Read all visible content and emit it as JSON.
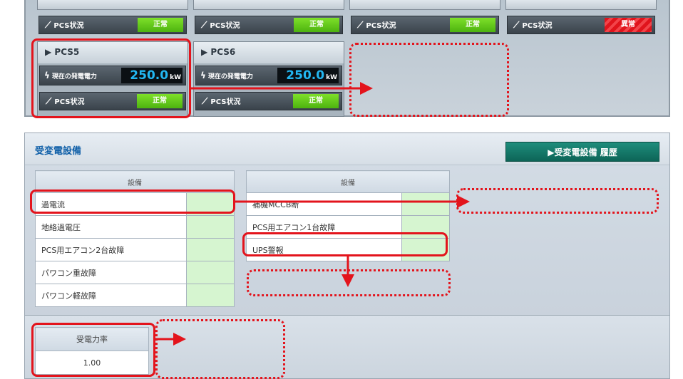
{
  "pcs_panel": {
    "top_status_rows": [
      {
        "label": "PCS状況",
        "status": "正常",
        "state": "ok"
      },
      {
        "label": "PCS状況",
        "status": "正常",
        "state": "ok"
      },
      {
        "label": "PCS状況",
        "status": "正常",
        "state": "ok"
      },
      {
        "label": "PCS状況",
        "status": "異常",
        "state": "error"
      }
    ],
    "cards": [
      {
        "title": "PCS5",
        "power_label": "現在の発電電力",
        "power_value": "250.0",
        "power_unit": "kW",
        "status_label": "PCS状況",
        "status": "正常"
      },
      {
        "title": "PCS6",
        "power_label": "現在の発電電力",
        "power_value": "250.0",
        "power_unit": "kW",
        "status_label": "PCS状況",
        "status": "正常"
      }
    ]
  },
  "substation": {
    "title": "受変電設備",
    "history_button": "▶受変電設備 履歴",
    "table1": {
      "header": "設備",
      "rows": [
        "過電流",
        "地絡過電圧",
        "PCS用エアコン2台故障",
        "パワコン重故障",
        "パワコン軽故障"
      ]
    },
    "table2": {
      "header": "設備",
      "rows": [
        "補機MCCB断",
        "PCS用エアコン1台故障",
        "UPS警報"
      ]
    }
  },
  "power_factor": {
    "header": "受電力率",
    "value": "1.00"
  },
  "colors": {
    "accent": "#0d6557",
    "ok": "#4db30f",
    "error": "#e0141c",
    "annotation": "#e3141c",
    "power_value": "#22b7f2"
  }
}
